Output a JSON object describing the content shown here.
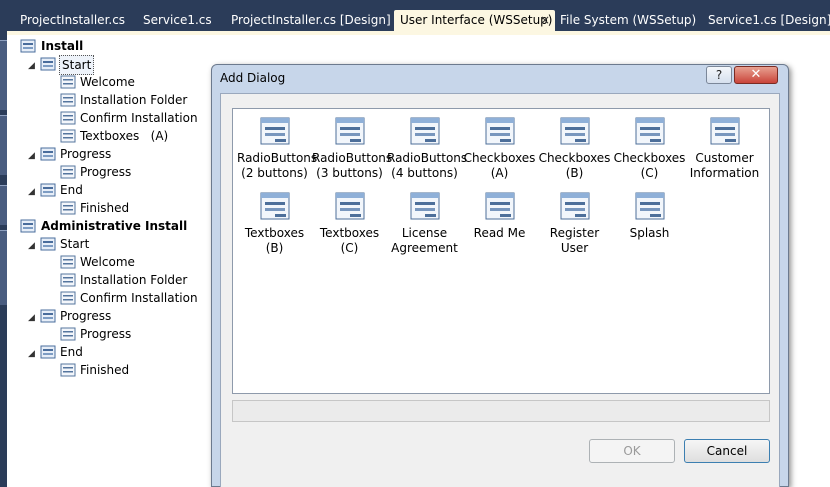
{
  "doc_tabs": [
    {
      "label": "ProjectInstaller.cs"
    },
    {
      "label": "Service1.cs"
    },
    {
      "label": "ProjectInstaller.cs [Design]"
    },
    {
      "label": "User Interface (WSSetup)",
      "active": true,
      "close": "×"
    },
    {
      "label": "File System (WSSetup)"
    },
    {
      "label": "Service1.cs [Design]"
    }
  ],
  "tree": {
    "install": {
      "label": "Install",
      "start": {
        "label": "Start",
        "items": [
          "Welcome",
          "Installation Folder",
          "Confirm Installation",
          "Textboxes   (A)"
        ]
      },
      "progress": {
        "label": "Progress",
        "items": [
          "Progress"
        ]
      },
      "end": {
        "label": "End",
        "items": [
          "Finished"
        ]
      }
    },
    "admin": {
      "label": "Administrative Install",
      "start": {
        "label": "Start",
        "items": [
          "Welcome",
          "Installation Folder",
          "Confirm Installation"
        ]
      },
      "progress": {
        "label": "Progress",
        "items": [
          "Progress"
        ]
      },
      "end": {
        "label": "End",
        "items": [
          "Finished"
        ]
      }
    }
  },
  "dialog": {
    "title": "Add Dialog",
    "help": "?",
    "close": "✕",
    "templates": [
      "RadioButtons\n(2 buttons)",
      "RadioButtons\n(3 buttons)",
      "RadioButtons\n(4 buttons)",
      "Checkboxes\n(A)",
      "Checkboxes\n(B)",
      "Checkboxes\n(C)",
      "Customer\nInformation",
      "Textboxes\n(B)",
      "Textboxes\n(C)",
      "License\nAgreement",
      "Read Me",
      "Register User",
      "Splash"
    ],
    "description": "",
    "ok_label": "OK",
    "cancel_label": "Cancel",
    "ok_enabled": false
  },
  "colors": {
    "ide_dark": "#2b3c59",
    "active_tab": "#fcf7e2",
    "dialog_frame": "#c7d6ea"
  }
}
